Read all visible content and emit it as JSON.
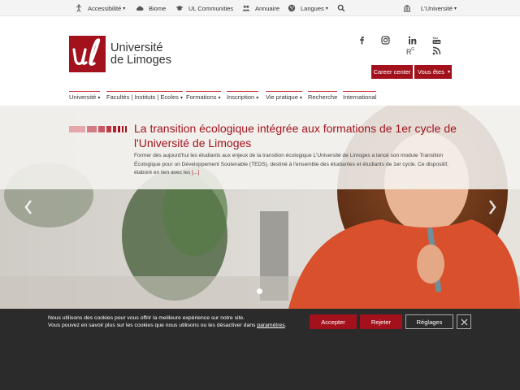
{
  "topbar": {
    "accessibility": "Accessibilité",
    "biome": "Biome",
    "ul_communities": "UL Communities",
    "annuaire": "Annuaire",
    "langues": "Langues",
    "universite": "L'Université"
  },
  "logo": {
    "line1": "Université",
    "line2": "de Limoges",
    "mark": "ul"
  },
  "social": [
    "facebook-icon",
    "instagram-icon",
    "linkedin-icon",
    "youtube-icon",
    "researchgate-icon",
    "rss-icon"
  ],
  "buttons": {
    "career_center": "Career center",
    "vous_etes": "Vous êtes"
  },
  "nav": {
    "items": [
      {
        "label": "Université",
        "dropdown": true
      },
      {
        "label": "Facultés | Instituts | Ecoles",
        "dropdown": true
      },
      {
        "label": "Formations",
        "dropdown": true
      },
      {
        "label": "Inscription",
        "dropdown": true
      },
      {
        "label": "Vie pratique",
        "dropdown": true
      },
      {
        "label": "Recherche",
        "dropdown": false
      },
      {
        "label": "International",
        "dropdown": false
      }
    ]
  },
  "hero": {
    "title": "La transition écologique intégrée aux formations de 1er cycle de l'Université de Limoges",
    "text": "Former dès aujourd'hui les étudiants aux enjeux de la transition écologique L'Université de Limoges a lancé son module Transition Écologique pour un Développement Soutenable (TEDS), destiné à l'ensemble des étudiantes et étudiants de 1er cycle. Ce dispositif, élaboré en lien avec les",
    "more": "[...]"
  },
  "cookie": {
    "line1": "Nous utilisons des cookies pour vous offrir la meilleure expérience sur notre site.",
    "line2": "Vous pouvez en savoir plus sur les cookies que nous utilisons ou les désactiver dans",
    "link": "paramètres",
    "after_link": ".",
    "accept": "Accepter",
    "reject": "Rejeter",
    "settings": "Réglages"
  },
  "colors": {
    "brand": "#a3121c",
    "cookie_bg": "#2b2b2b",
    "topbar_bg": "#f4f4f4"
  }
}
